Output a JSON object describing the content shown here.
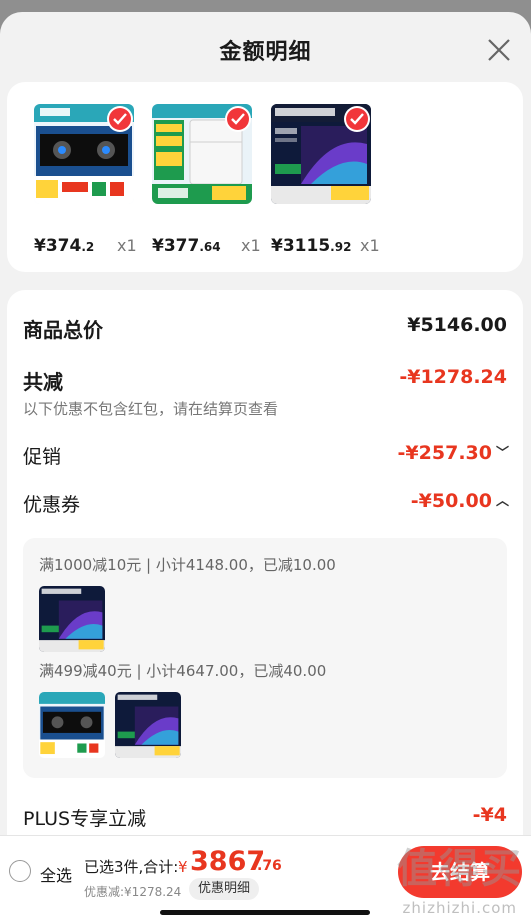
{
  "header": {
    "title": "金额明细"
  },
  "products": [
    {
      "price_int": "¥374",
      "price_dec": ".2",
      "qty": "x1"
    },
    {
      "price_int": "¥377",
      "price_dec": ".64",
      "qty": "x1"
    },
    {
      "price_int": "¥3115",
      "price_dec": ".92",
      "qty": "x1"
    }
  ],
  "details": {
    "goods_total_label": "商品总价",
    "goods_total_value": "¥5146.00",
    "reduction_label": "共减",
    "reduction_value": "-¥1278.24",
    "reduction_note": "以下优惠不包含红包，请在结算页查看",
    "promo_label": "促销",
    "promo_value": "-¥257.30",
    "coupon_label": "优惠券",
    "coupon_value": "-¥50.00",
    "coupon_rules": [
      "满1000减10元 | 小计4148.00，已减10.00",
      "满499减40元 | 小计4647.00，已减40.00"
    ],
    "plus_label": "PLUS专享立减",
    "plus_value": "-¥4"
  },
  "bottom": {
    "select_all": "全选",
    "summary": "已选3件,合计:",
    "total_yen": "¥",
    "total_int": "3867",
    "total_dec": ".76",
    "saved": "优惠减:¥1278.24",
    "detail_button": "优惠明细",
    "checkout_button": "去结算"
  },
  "watermark": {
    "main": "值得买",
    "sub": "zhizhizhi.com"
  },
  "colors": {
    "accent_red": "#e8361f",
    "sheet_bg": "#f2f2f2"
  }
}
